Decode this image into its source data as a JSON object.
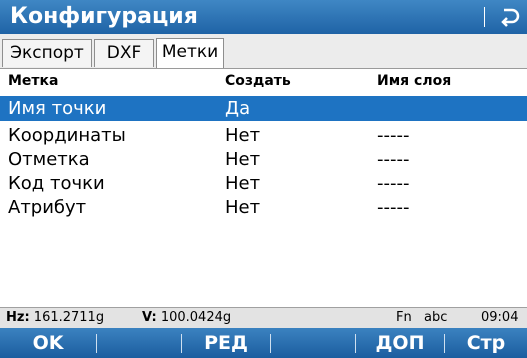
{
  "window": {
    "title": "Конфигурация",
    "back_icon": "return-arrow-icon"
  },
  "tabs": [
    {
      "label": "Экспорт",
      "active": false
    },
    {
      "label": "DXF",
      "active": false
    },
    {
      "label": "Метки",
      "active": true
    }
  ],
  "table": {
    "columns": [
      "Метка",
      "Создать",
      "Имя слоя"
    ],
    "rows": [
      {
        "label": "Имя точки",
        "create": "Да",
        "layer": "",
        "selected": true
      },
      {
        "label": "Координаты",
        "create": "Нет",
        "layer": "-----",
        "selected": false
      },
      {
        "label": "Отметка",
        "create": "Нет",
        "layer": "-----",
        "selected": false
      },
      {
        "label": "Код точки",
        "create": "Нет",
        "layer": "-----",
        "selected": false
      },
      {
        "label": "Атрибут",
        "create": "Нет",
        "layer": "-----",
        "selected": false
      }
    ]
  },
  "status": {
    "hz_label": "Hz:",
    "hz_value": "161.2711g",
    "v_label": "V:",
    "v_value": "100.0424g",
    "fn": "Fn",
    "input_mode": "abc",
    "time": "09:04"
  },
  "softkeys": {
    "f1": "OK",
    "f2": "",
    "f3": "РЕД",
    "f4": "",
    "f5": "ДОП",
    "f6": "Стр"
  },
  "colors": {
    "titlebar": "#1f63a6",
    "selection": "#1e73c2",
    "softkey_bar": "#1b5d9f"
  }
}
